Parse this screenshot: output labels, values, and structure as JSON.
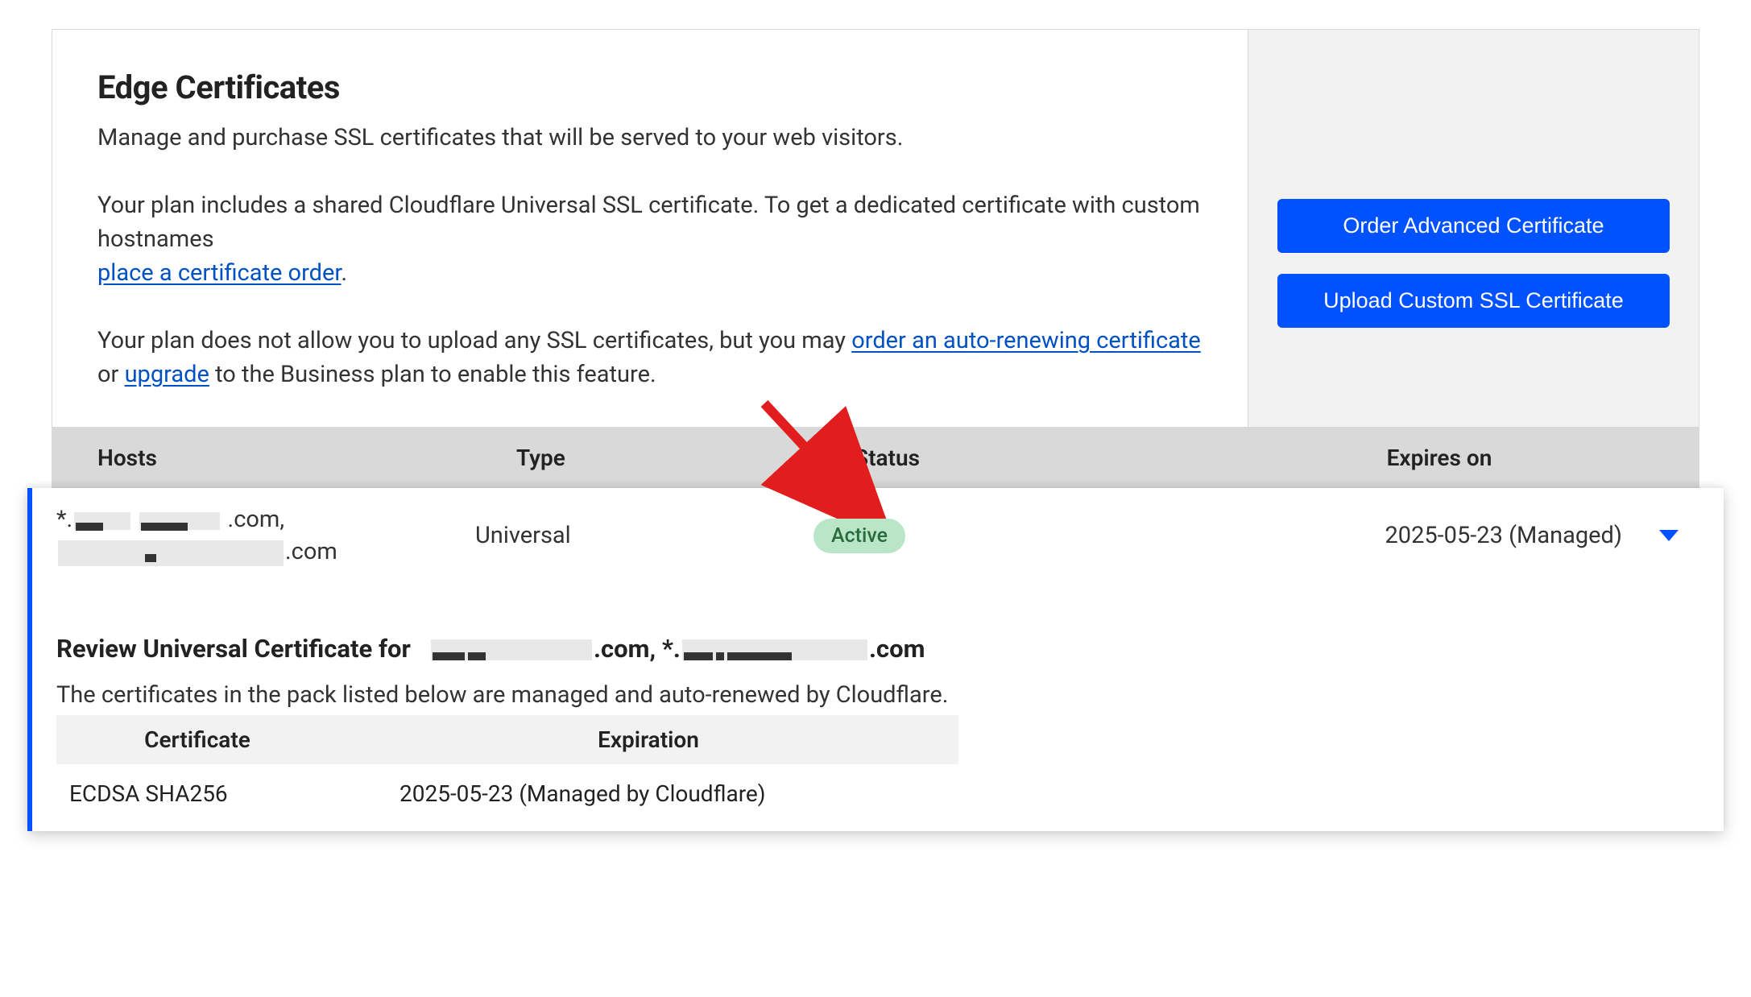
{
  "header": {
    "title": "Edge Certificates",
    "lead": "Manage and purchase SSL certificates that will be served to your web visitors.",
    "para2_prefix": "Your plan includes a shared Cloudflare Universal SSL certificate. To get a dedicated certificate with custom hostnames",
    "link_place_order": "place a certificate order",
    "para2_suffix": ".",
    "para3_prefix": "Your plan does not allow you to upload any SSL certificates, but you may ",
    "link_order_auto_renew": "order an auto-renewing certificate",
    "para3_or": " or ",
    "link_upgrade": "upgrade",
    "para3_suffix": " to the Business plan to enable this feature."
  },
  "side": {
    "btn_order_advanced": "Order Advanced Certificate",
    "btn_upload_custom": "Upload Custom SSL Certificate"
  },
  "table": {
    "headers": {
      "hosts": "Hosts",
      "type": "Type",
      "status": "Status",
      "expires": "Expires on"
    }
  },
  "cert": {
    "host_line1_prefix": "*.",
    "host_line1_suffix": ".com,",
    "host_line2_suffix": ".com",
    "type": "Universal",
    "status_label": "Active",
    "expires": "2025-05-23 (Managed)"
  },
  "detail": {
    "title_prefix": "Review Universal Certificate for ",
    "title_mid": ".com, *.",
    "title_suffix": ".com",
    "subtitle": "The certificates in the pack listed below are managed and auto-renewed by Cloudflare.",
    "col_certificate": "Certificate",
    "col_expiration": "Expiration",
    "row_cert": "ECDSA SHA256",
    "row_exp": "2025-05-23 (Managed by Cloudflare)"
  }
}
